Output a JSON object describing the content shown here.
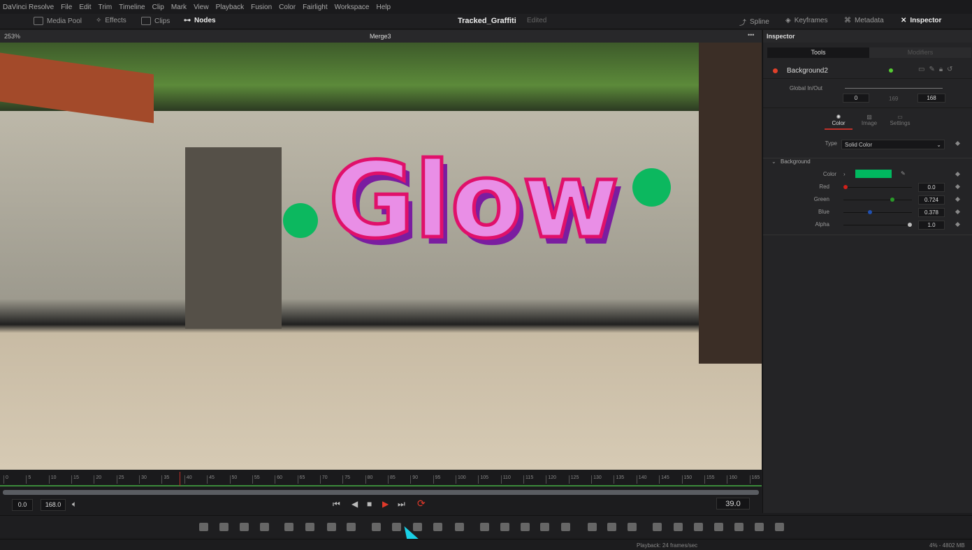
{
  "menu": [
    "DaVinci Resolve",
    "File",
    "Edit",
    "Trim",
    "Timeline",
    "Clip",
    "Mark",
    "View",
    "Playback",
    "Fusion",
    "Color",
    "Fairlight",
    "Workspace",
    "Help"
  ],
  "toolbar": {
    "media_pool": "Media Pool",
    "effects": "Effects",
    "clips": "Clips",
    "nodes": "Nodes",
    "project_title": "Tracked_Graffiti",
    "edited": "Edited",
    "spline": "Spline",
    "keyframes": "Keyframes",
    "metadata": "Metadata",
    "inspector": "Inspector"
  },
  "viewer": {
    "zoom": "253%",
    "node_name": "Merge3",
    "graffiti_text": "Glow"
  },
  "timeline": {
    "ticks": [
      "0",
      "5",
      "10",
      "15",
      "20",
      "25",
      "30",
      "35",
      "40",
      "45",
      "50",
      "55",
      "60",
      "65",
      "70",
      "75",
      "80",
      "85",
      "90",
      "95",
      "100",
      "105",
      "110",
      "115",
      "120",
      "125",
      "130",
      "135",
      "140",
      "145",
      "150",
      "155",
      "160",
      "165"
    ],
    "current_frame": 39,
    "start": "0.0",
    "end": "168.0",
    "frame_display": "39.0"
  },
  "inspector": {
    "title": "Inspector",
    "tabs": [
      "Tools",
      "Modifiers"
    ],
    "node": "Background2",
    "global_inout_label": "Global In/Out",
    "in": "0",
    "mid": "169",
    "out": "168",
    "subtabs": [
      "Color",
      "Image",
      "Settings"
    ],
    "type_label": "Type",
    "type_value": "Solid Color",
    "section": "Background",
    "color_label": "Color",
    "color_swatch": "#00b85f",
    "channels": [
      {
        "label": "Red",
        "value": "0.0",
        "fraction": 0.0,
        "color": "#d0201a"
      },
      {
        "label": "Green",
        "value": "0.724",
        "fraction": 0.724,
        "color": "#2a9a2a"
      },
      {
        "label": "Blue",
        "value": "0.378",
        "fraction": 0.378,
        "color": "#2050b0"
      },
      {
        "label": "Alpha",
        "value": "1.0",
        "fraction": 1.0,
        "color": "#bbbbbb"
      }
    ]
  },
  "status": {
    "playback": "Playback: 24 frames/sec",
    "memory": "4% - 4802 MB"
  }
}
